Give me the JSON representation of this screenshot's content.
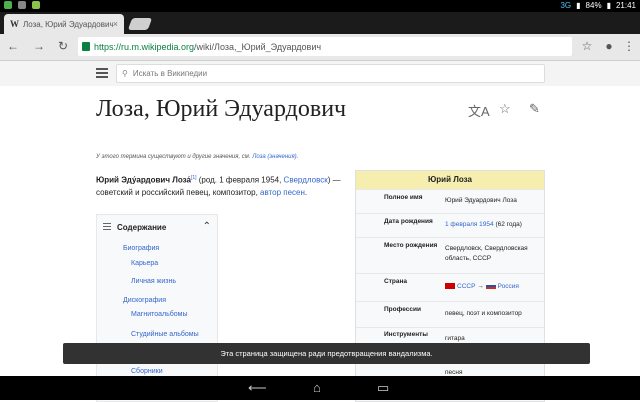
{
  "status_bar": {
    "network": "3G",
    "battery": "84%",
    "time": "21:41"
  },
  "browser": {
    "tab_favicon": "W",
    "tab_title": "Лоза, Юрий Эдуардович –",
    "tab_close": "×",
    "url_host": "https://ru.m.wikipedia.org",
    "url_path": "/wiki/Лоза,_Юрий_Эдуардович",
    "icons": [
      "back-arrow-icon",
      "forward-arrow-icon",
      "reload-icon",
      "lock-icon",
      "star-icon",
      "mic-icon",
      "overflow-menu-icon"
    ]
  },
  "wiki": {
    "search_placeholder": "Искать в Википедии",
    "title": "Лоза, Юрий Эдуардович",
    "hatnote_prefix": "У этого термина существуют и другие значения, см.",
    "hatnote_link": "Лоза (значения)",
    "hatnote_suffix": ".",
    "lead": {
      "name_bold": "Юрий Эду́ардович Лоза́",
      "sup": "[1]",
      "text1": " (род. 1 февраля 1954, ",
      "link1": "Свердловск",
      "text2": ") — советский и российский певец, композитор, ",
      "link2": "автор песен",
      "text3": "."
    },
    "toc": {
      "header": "Содержание",
      "items": [
        "Биография",
        "Карьера",
        "Личная жизнь",
        "Дискография",
        "Магнитоальбомы",
        "Студийные альбомы",
        "Сборники"
      ]
    },
    "infobox": {
      "title": "Юрий Лоза",
      "rows": [
        {
          "label": "Полное имя",
          "value": "Юрий Эдуардович Лоза"
        },
        {
          "label": "Дата рождения",
          "value_link": "1 февраля 1954",
          "value_text": " (62 года)"
        },
        {
          "label": "Место рождения",
          "value_link": "Свердловск, Свердловская область, СССР"
        },
        {
          "label": "Страна",
          "flag1": "СССР",
          "arrow": "→",
          "flag2": "Россия"
        },
        {
          "label": "Профессии",
          "value_link": "певец, поэт и композитор"
        },
        {
          "label": "Инструменты",
          "value_link": "гитара"
        },
        {
          "label": "",
          "value_link": "песня"
        }
      ]
    },
    "snackbar": "Эта страница защищена ради предотвращения вандализма."
  },
  "nav": {
    "back": "⟵",
    "home": "⌂",
    "recents": "▭"
  }
}
